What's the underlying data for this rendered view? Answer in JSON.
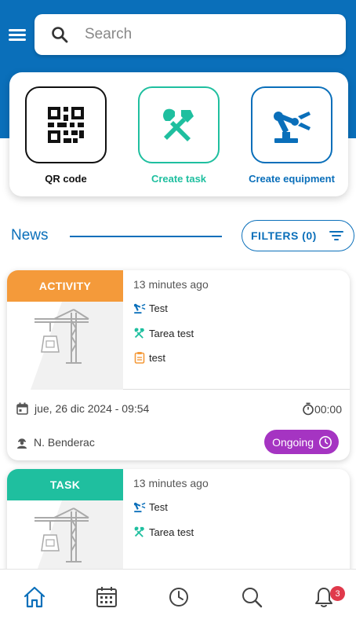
{
  "search": {
    "placeholder": "Search"
  },
  "actions": [
    {
      "label": "QR code"
    },
    {
      "label": "Create task"
    },
    {
      "label": "Create equipment"
    }
  ],
  "news": {
    "title": "News",
    "filters_label": "FILTERS (0)"
  },
  "cards": [
    {
      "badge": "ACTIVITY",
      "time_ago": "13 minutes ago",
      "equipment": "Test",
      "task": "Tarea test",
      "activity": "test",
      "date": "jue, 26 dic 2024 - 09:54",
      "duration": "00:00",
      "user": "N. Benderac",
      "status": "Ongoing"
    },
    {
      "badge": "TASK",
      "time_ago": "13 minutes ago",
      "equipment": "Test",
      "task": "Tarea test"
    }
  ],
  "nav": {
    "notifications_count": "3"
  },
  "colors": {
    "primary": "#0a6fba",
    "task_green": "#1fbf9f",
    "activity_orange": "#f49a3a",
    "ongoing_purple": "#a534c2",
    "badge_red": "#e0394b"
  }
}
